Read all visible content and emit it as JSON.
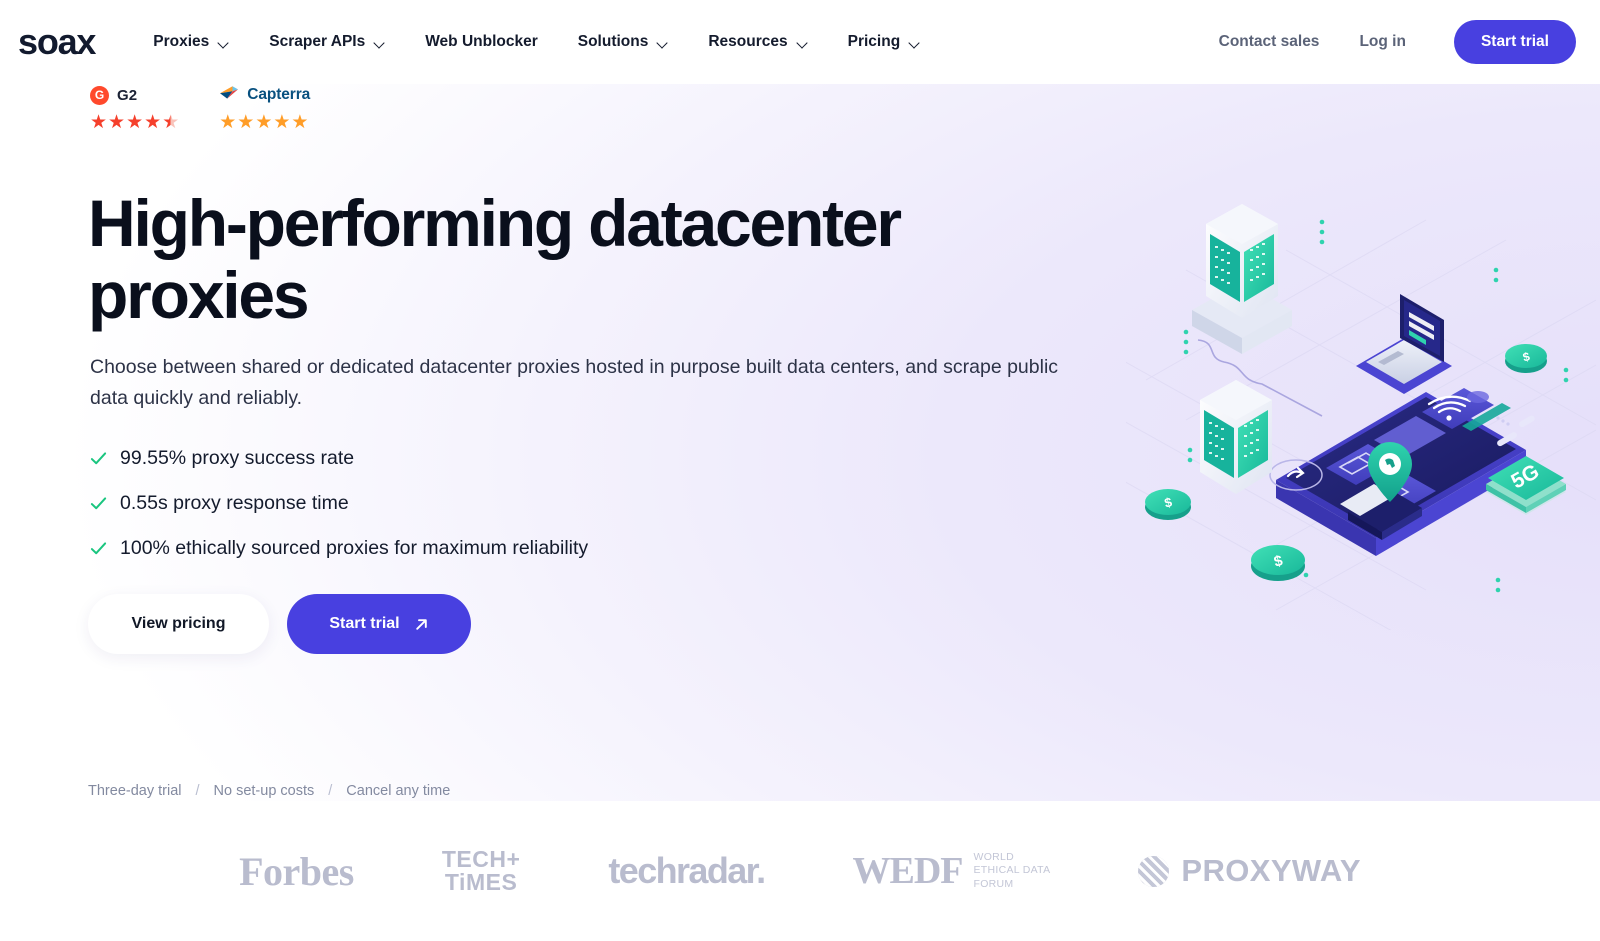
{
  "brand": {
    "name": "soax"
  },
  "nav": {
    "items": [
      {
        "label": "Proxies",
        "has_dropdown": true
      },
      {
        "label": "Scraper APIs",
        "has_dropdown": true
      },
      {
        "label": "Web Unblocker",
        "has_dropdown": false
      },
      {
        "label": "Solutions",
        "has_dropdown": true
      },
      {
        "label": "Resources",
        "has_dropdown": true
      },
      {
        "label": "Pricing",
        "has_dropdown": true
      }
    ],
    "contact_sales": "Contact sales",
    "log_in": "Log in",
    "start_trial": "Start trial"
  },
  "badges": [
    {
      "name": "G2",
      "logo_icon": "g2-icon",
      "logo_color": "#ff492c",
      "star_color": "#f5402c",
      "stars": 4.5,
      "stars_glyphs": [
        "★",
        "★",
        "★",
        "★",
        "★"
      ]
    },
    {
      "name": "Capterra",
      "logo_icon": "capterra-icon",
      "logo_color": "#08507f",
      "star_color": "#ff9d28",
      "stars": 5,
      "stars_glyphs": [
        "★",
        "★",
        "★",
        "★",
        "★"
      ]
    }
  ],
  "hero": {
    "headline": "High-performing datacenter proxies",
    "subcopy": "Choose between shared or dedicated datacenter proxies hosted in purpose built data centers, and scrape public data quickly and reliably.",
    "bullets": [
      {
        "icon": "check-icon",
        "text": "99.55% proxy success rate"
      },
      {
        "icon": "check-icon",
        "text": "0.55s proxy response time"
      },
      {
        "icon": "check-icon",
        "text": "100% ethically sourced proxies for maximum reliability"
      }
    ],
    "cta_secondary": "View pricing",
    "cta_primary": "Start trial",
    "cta_primary_icon": "arrow-up-right-icon",
    "fineprint": [
      "Three-day trial",
      "No set-up costs",
      "Cancel any time"
    ],
    "fineprint_separator": "/",
    "illustration_name": "isometric-datacenter-proxy-illustration",
    "accent_color": "#4840e0",
    "check_color": "#19c57f"
  },
  "logos": {
    "forbes": "Forbes",
    "techtimes_line1": "TECH+",
    "techtimes_line2": "TiMES",
    "techradar": "techradar.",
    "wedf_main": "WEDF",
    "wedf_sub_line1": "WORLD",
    "wedf_sub_line2": "ETHICAL DATA",
    "wedf_sub_line3": "FORUM",
    "proxyway": "PROXYWAY"
  }
}
